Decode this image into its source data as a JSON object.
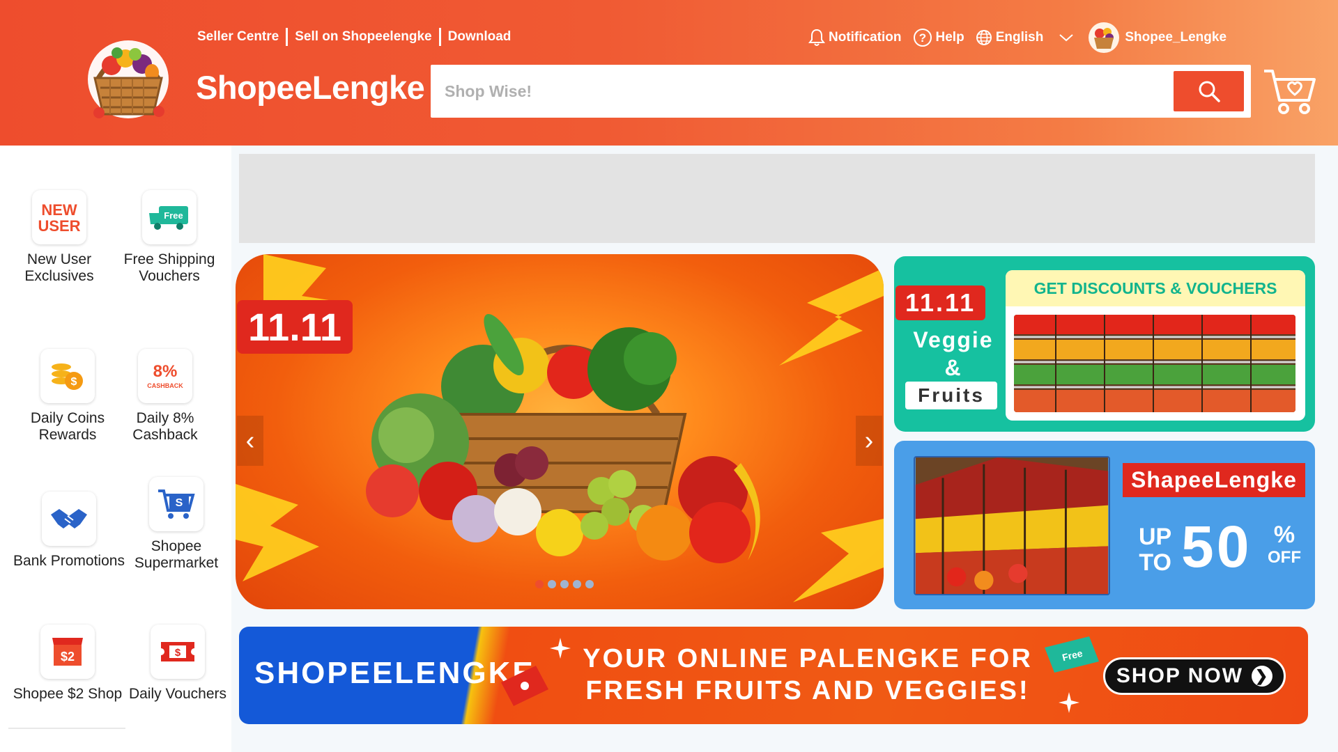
{
  "header": {
    "brand": "ShopeeLengke",
    "top_links": [
      "Seller Centre",
      "Sell on Shopeelengke",
      "Download"
    ],
    "notification": "Notification",
    "help": "Help",
    "language": "English",
    "username": "Shopee_Lengke",
    "search_placeholder": "Shop Wise!",
    "accent": "#ee4d2d"
  },
  "sidebar": {
    "items": [
      {
        "label": "New User Exclusives",
        "icon": "new-user-icon",
        "icon_text": "NEW\nUSER"
      },
      {
        "label": "Free Shipping Vouchers",
        "icon": "free-shipping-truck-icon",
        "icon_text": "Free"
      },
      {
        "label": "Daily Coins Rewards",
        "icon": "coins-icon"
      },
      {
        "label": "Daily 8% Cashback",
        "icon": "cashback-icon",
        "icon_text": "8%",
        "icon_subtext": "CASHBACK"
      },
      {
        "label": "Bank Promotions",
        "icon": "handshake-icon"
      },
      {
        "label": "Shopee Supermarket",
        "icon": "supermarket-cart-icon",
        "icon_text": "S"
      },
      {
        "label": "Shopee $2 Shop",
        "icon": "two-dollar-shop-icon",
        "icon_text": "$2"
      },
      {
        "label": "Daily Vouchers",
        "icon": "voucher-ticket-icon",
        "icon_text": "$"
      }
    ]
  },
  "carousel": {
    "badge": "11.11",
    "prev": "‹",
    "next": "›",
    "slide_count": 5,
    "active_slide": 1
  },
  "promo_green": {
    "badge": "11.11",
    "veggie": "Veggie",
    "amp": "&",
    "fruits": "Fruits",
    "card_title": "GET DISCOUNTS & VOUCHERS"
  },
  "promo_blue": {
    "name": "ShapeeLengke",
    "up": "UP",
    "to": "TO",
    "value": "50",
    "pct": "%",
    "off": "OFF"
  },
  "banner": {
    "title": "SHOPEELENGKE",
    "line1": "YOUR ONLINE PALENGKE FOR",
    "line2": "FRESH FRUITS AND VEGGIES!",
    "cta": "SHOP NOW",
    "tag": "Free"
  }
}
